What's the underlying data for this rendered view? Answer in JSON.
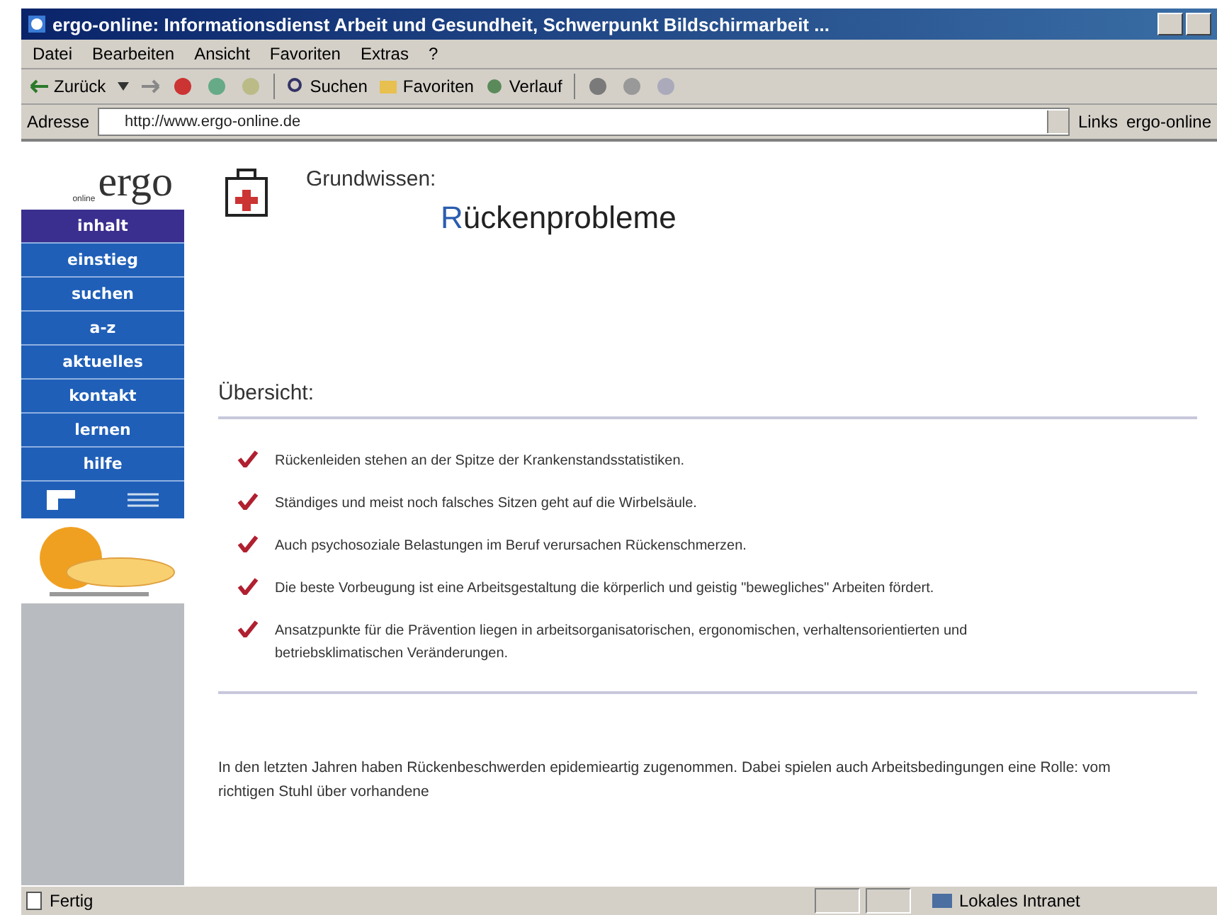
{
  "window": {
    "title": "ergo-online: Informationsdienst Arbeit und Gesundheit, Schwerpunkt Bildschirmarbeit ..."
  },
  "menu": [
    "Datei",
    "Bearbeiten",
    "Ansicht",
    "Favoriten",
    "Extras",
    "?"
  ],
  "toolbar": {
    "back": "Zurück",
    "search": "Suchen",
    "favorites": "Favoriten",
    "history": "Verlauf"
  },
  "address": {
    "label": "Adresse",
    "value": "http://www.ergo-online.de",
    "links_label": "Links",
    "link": "ergo-online"
  },
  "sidebar": {
    "logo": "ergo",
    "logo_sub": "online",
    "items": [
      {
        "label": "inhalt",
        "selected": true
      },
      {
        "label": "einstieg",
        "selected": false
      },
      {
        "label": "suchen",
        "selected": false
      },
      {
        "label": "a-z",
        "selected": false
      },
      {
        "label": "aktuelles",
        "selected": false
      },
      {
        "label": "kontakt",
        "selected": false
      },
      {
        "label": "lernen",
        "selected": false
      },
      {
        "label": "hilfe",
        "selected": false
      }
    ]
  },
  "page": {
    "kicker": "Grundwissen:",
    "title": "Rückenprobleme",
    "section": "Übersicht:",
    "bullets": [
      "Rückenleiden stehen an der Spitze der Krankenstandsstatistiken.",
      "Ständiges und meist noch falsches Sitzen geht auf die Wirbelsäule.",
      "Auch psychosoziale Belastungen im Beruf verursachen Rückenschmerzen.",
      "Die beste Vorbeugung ist eine Arbeitsgestaltung die körperlich und geistig \"bewegliches\" Arbeiten fördert.",
      "Ansatzpunkte für die Prävention liegen in arbeitsorganisatorischen, ergonomischen, verhaltensorientierten und betriebsklimatischen Veränderungen."
    ],
    "paragraph": "In den letzten Jahren haben Rückenbeschwerden epidemieartig zugenommen. Dabei spielen auch Arbeitsbedingungen eine Rolle: vom richtigen Stuhl über vorhandene"
  },
  "status_bar": {
    "status": "Fertig",
    "zone": "Lokales Intranet"
  }
}
